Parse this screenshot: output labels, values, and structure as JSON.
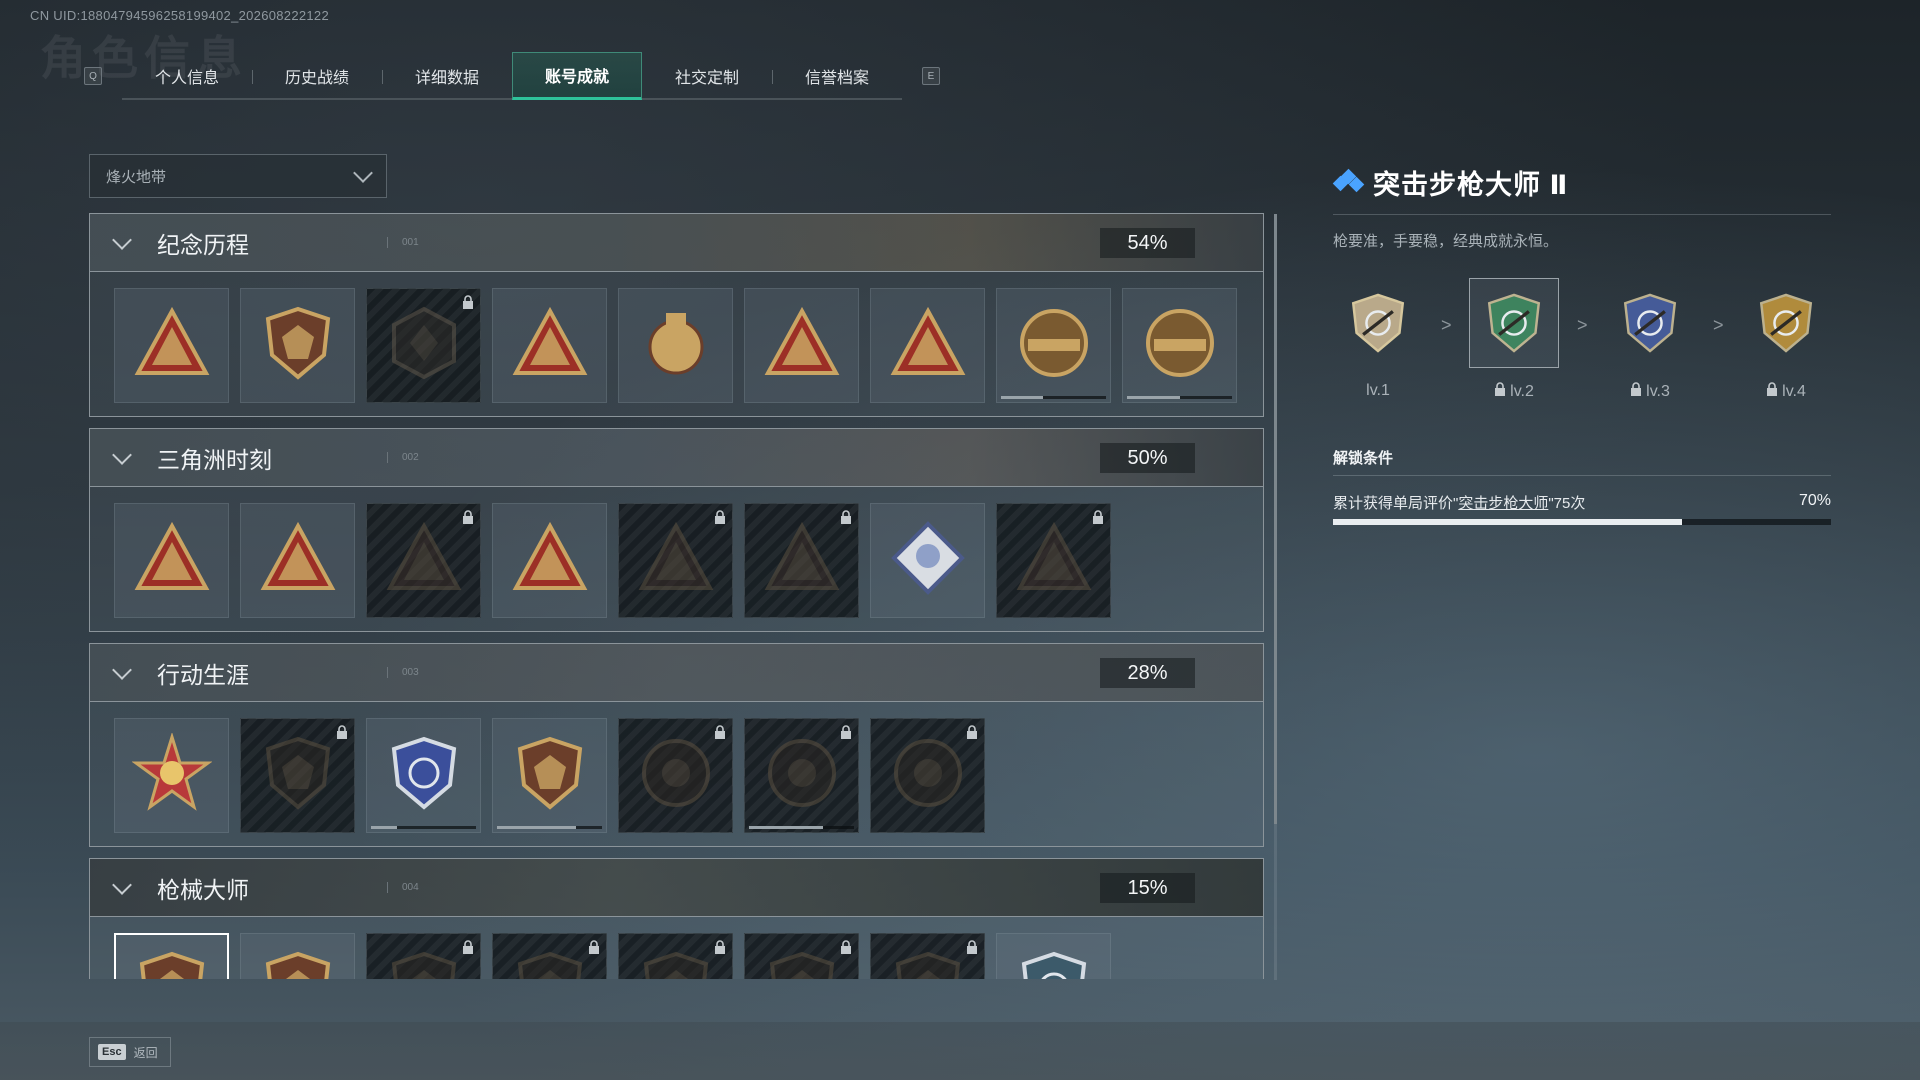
{
  "uid_text": "CN UID:18804794596258199402_202608222122",
  "ghost_title": "角色信息",
  "tabs": {
    "left_key": "Q",
    "right_key": "E",
    "items": [
      "个人信息",
      "历史战绩",
      "详细数据",
      "账号成就",
      "社交定制",
      "信誉档案"
    ],
    "active_index": 3
  },
  "filter": {
    "selected": "烽火地带"
  },
  "categories": [
    {
      "name": "纪念历程",
      "num": "001",
      "percent": "54%",
      "badges": [
        {
          "icon": "triangle-badge-icon",
          "locked": false
        },
        {
          "icon": "helicopter-badge-icon",
          "locked": false
        },
        {
          "icon": "hex-emblem-icon",
          "locked": true
        },
        {
          "icon": "calendar-triangle-icon",
          "locked": false
        },
        {
          "icon": "gold-bag-icon",
          "locked": false
        },
        {
          "icon": "cloud-triangle-icon",
          "locked": false
        },
        {
          "icon": "number-one-triangle-icon",
          "locked": false
        },
        {
          "icon": "delta-force-badge-icon",
          "locked": false,
          "progress": 0.4
        },
        {
          "icon": "delta-force-2026-badge-icon",
          "locked": false,
          "progress": 0.5
        }
      ]
    },
    {
      "name": "三角洲时刻",
      "num": "002",
      "percent": "50%",
      "badges": [
        {
          "icon": "flag-triangle-icon",
          "locked": false
        },
        {
          "icon": "soldier-triangle-icon",
          "locked": false
        },
        {
          "icon": "chip-triangle-icon",
          "locked": true
        },
        {
          "icon": "squad-triangle-icon",
          "locked": false
        },
        {
          "icon": "group-triangle-icon",
          "locked": true
        },
        {
          "icon": "fish-triangle-icon",
          "locked": true
        },
        {
          "icon": "rose-diamond-icon",
          "locked": false
        },
        {
          "icon": "dragon-triangle-icon",
          "locked": true
        }
      ]
    },
    {
      "name": "行动生涯",
      "num": "003",
      "percent": "28%",
      "badges": [
        {
          "icon": "star-compass-icon",
          "locked": false
        },
        {
          "icon": "wing-shield-icon",
          "locked": true
        },
        {
          "icon": "police-shield-icon",
          "locked": false,
          "progress": 0.25
        },
        {
          "icon": "gem-shield-icon",
          "locked": false,
          "progress": 0.75
        },
        {
          "icon": "round-helmet-icon",
          "locked": true
        },
        {
          "icon": "round-skull-icon",
          "locked": true,
          "progress": 0.7
        },
        {
          "icon": "round-eye-icon",
          "locked": true
        }
      ]
    },
    {
      "name": "枪械大师",
      "num": "004",
      "percent": "15%",
      "badges": [
        {
          "icon": "rifle-shield-icon",
          "locked": false,
          "selected": true
        },
        {
          "icon": "rifle-shield-icon",
          "locked": false
        },
        {
          "icon": "rifle-shield-icon",
          "locked": true
        },
        {
          "icon": "rifle-shield-icon",
          "locked": true
        },
        {
          "icon": "rifle-shield-icon",
          "locked": true
        },
        {
          "icon": "rifle-shield-icon",
          "locked": true
        },
        {
          "icon": "rifle-shield-icon",
          "locked": true
        },
        {
          "icon": "crosshair-shield-icon",
          "locked": false
        }
      ]
    }
  ],
  "detail": {
    "title": "突击步枪大师 Ⅱ",
    "description": "枪要准，手要稳，经典成就永恒。",
    "levels": [
      {
        "label": "lv.1",
        "locked": false,
        "color": "#b9a98a"
      },
      {
        "label": "lv.2",
        "locked": true,
        "color": "#3f8f62",
        "current": true
      },
      {
        "label": "lv.3",
        "locked": true,
        "color": "#4a62a8"
      },
      {
        "label": "lv.4",
        "locked": true,
        "color": "#c89a3c"
      }
    ],
    "unlock_title": "解锁条件",
    "condition_prefix": "累计获得单局评价\"",
    "condition_link": "突击步枪大师",
    "condition_suffix": "\"75次",
    "condition_percent": "70%",
    "condition_progress": 0.7
  },
  "footer": {
    "key": "Esc",
    "label": "返回"
  }
}
